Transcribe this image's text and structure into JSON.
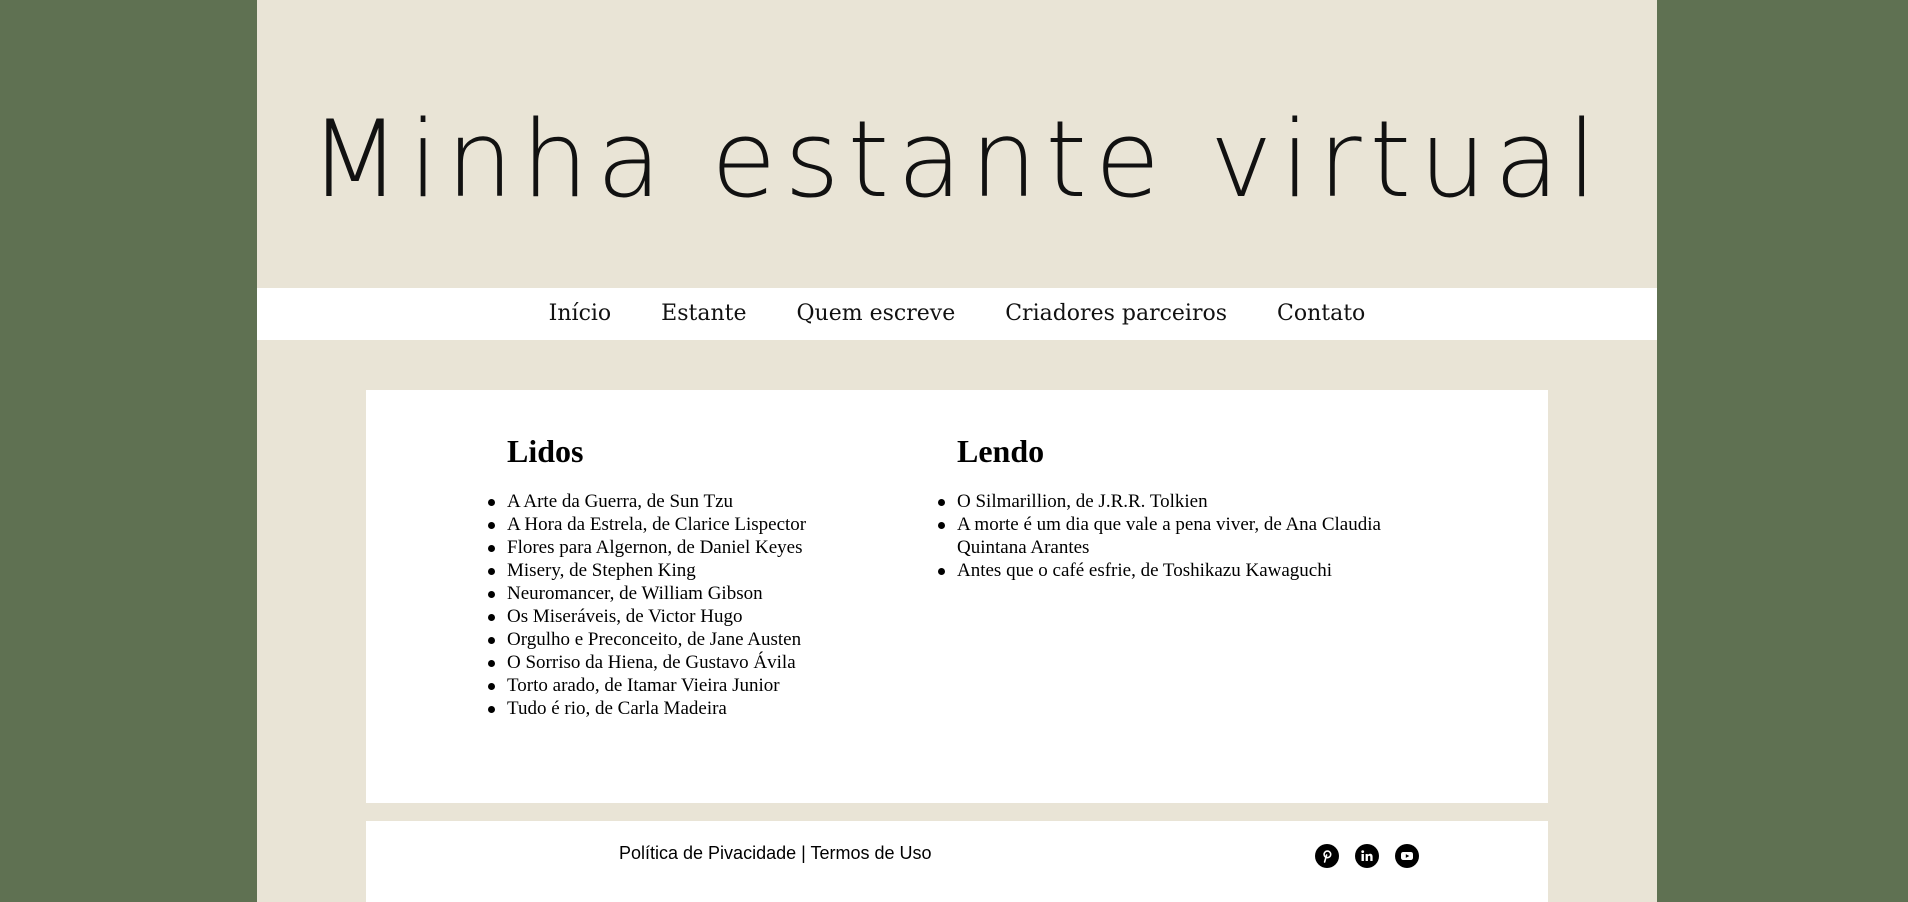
{
  "header": {
    "title": "Minha estante virtual"
  },
  "nav": {
    "items": [
      {
        "label": "Início"
      },
      {
        "label": "Estante"
      },
      {
        "label": "Quem escreve"
      },
      {
        "label": "Criadores parceiros"
      },
      {
        "label": "Contato"
      }
    ]
  },
  "shelf": {
    "read": {
      "heading": "Lidos",
      "books": [
        "A Arte da Guerra, de Sun Tzu",
        "A Hora da Estrela, de Clarice Lispector",
        "Flores para Algernon, de Daniel Keyes",
        "Misery, de Stephen King",
        "Neuromancer, de William Gibson",
        "Os Miseráveis, de Victor Hugo",
        "Orgulho e Preconceito, de Jane Austen",
        "O Sorriso da Hiena, de Gustavo Ávila",
        "Torto arado, de Itamar Vieira Junior",
        "Tudo é rio, de Carla Madeira"
      ]
    },
    "reading": {
      "heading": "Lendo",
      "books": [
        "O Silmarillion, de J.R.R. Tolkien",
        "A morte é um dia que vale a pena viver, de Ana Claudia Quintana Arantes",
        "Antes que o café esfrie, de Toshikazu Kawaguchi"
      ]
    }
  },
  "footer": {
    "privacy": "Política de Pivacidade",
    "separator": " | ",
    "terms": "Termos de Uso",
    "social": [
      {
        "icon": "pinterest-icon"
      },
      {
        "icon": "linkedin-icon"
      },
      {
        "icon": "youtube-icon"
      }
    ]
  },
  "colors": {
    "outer_background": "#5f7152",
    "page_background": "#e9e4d6",
    "card_background": "#ffffff",
    "text": "#000000"
  }
}
